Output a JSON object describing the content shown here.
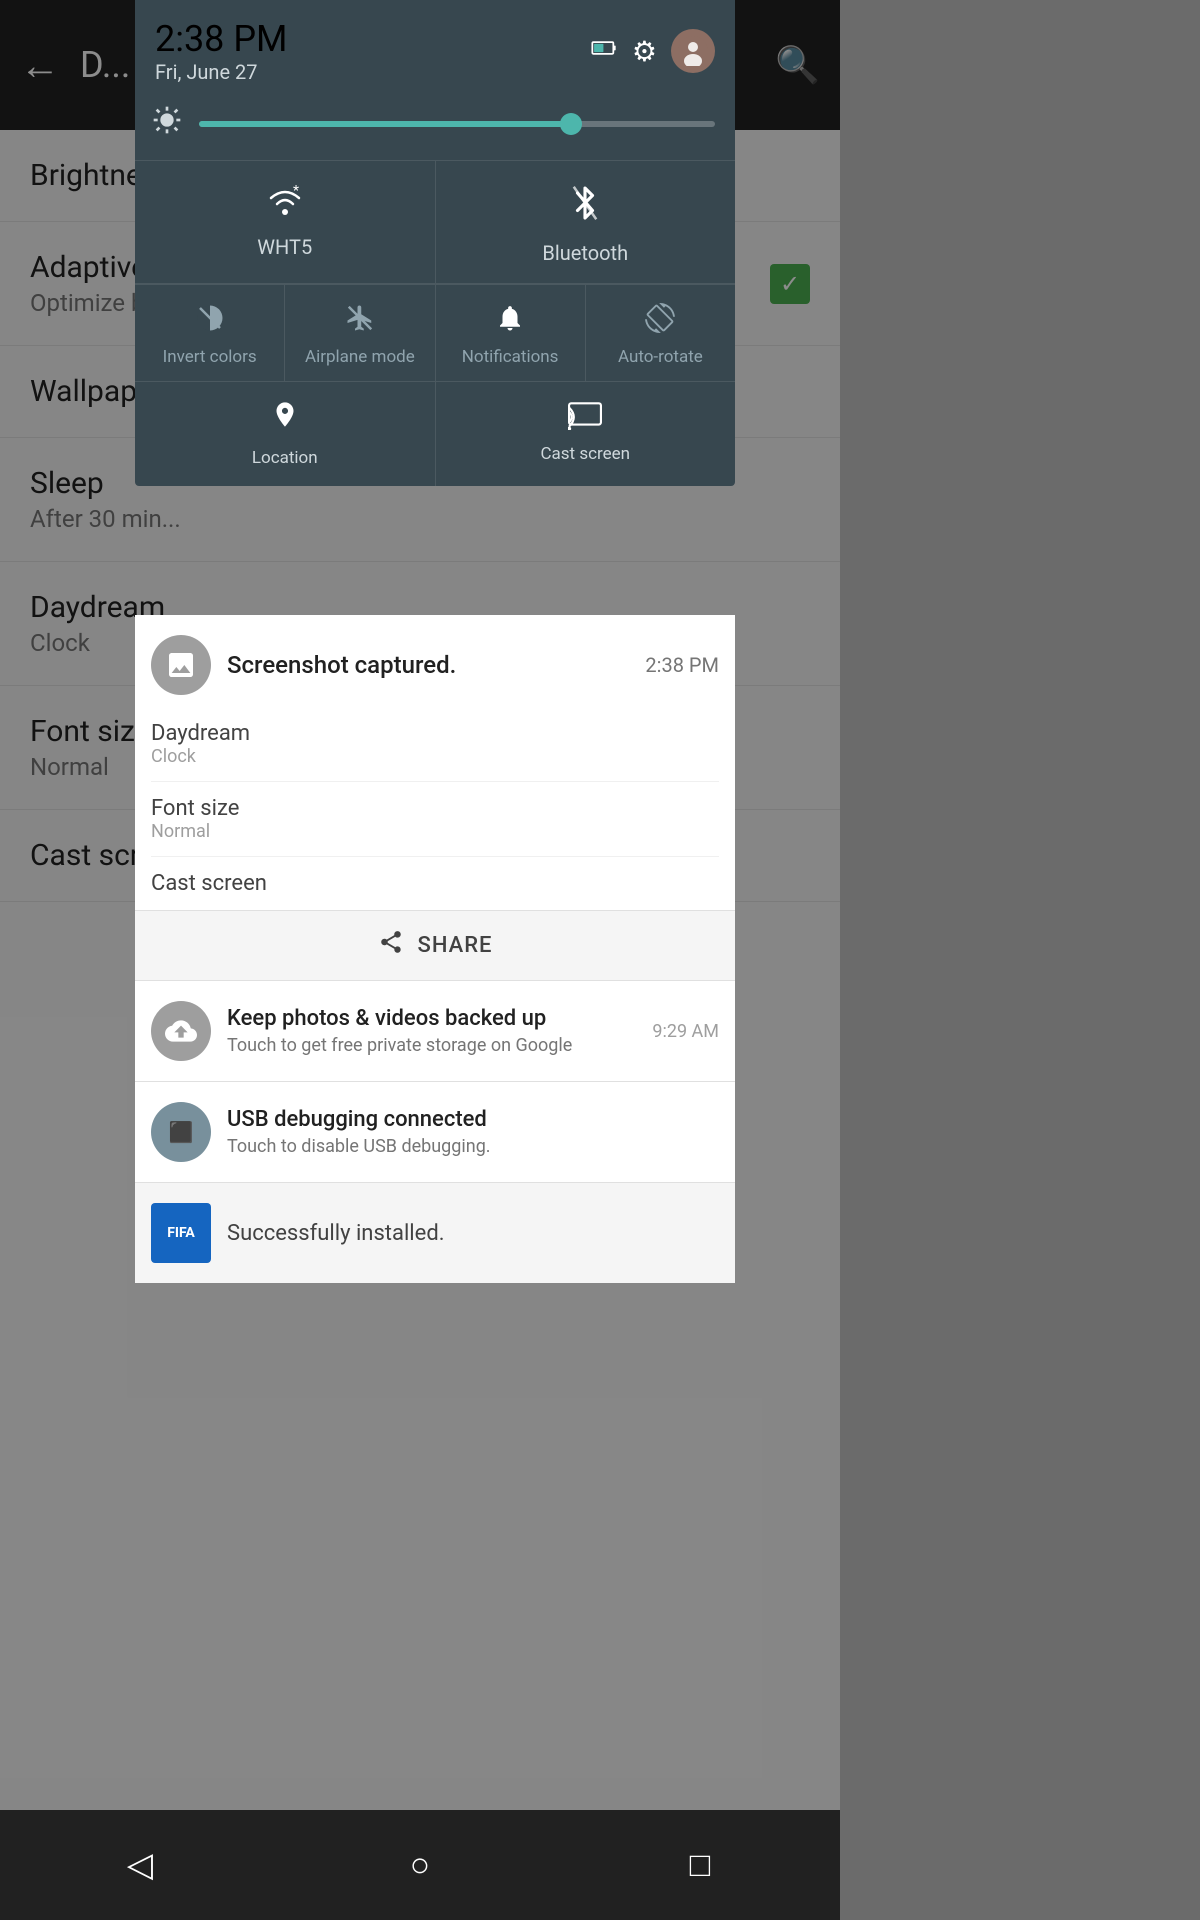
{
  "statusBar": {
    "time": "2:38 PM",
    "date": "Fri, June 27",
    "batteryIcon": "🔋",
    "settingsIcon": "⚙",
    "avatarLabel": "👤"
  },
  "brightness": {
    "iconLabel": "☀",
    "fillPercent": 72
  },
  "wifiTile": {
    "icon": "wifi",
    "label": "WHT5"
  },
  "bluetoothTile": {
    "icon": "bluetooth",
    "label": "Bluetooth"
  },
  "secondaryTiles": [
    {
      "id": "invert-colors",
      "icon": "invert",
      "label": "Invert colors"
    },
    {
      "id": "airplane-mode",
      "icon": "airplane",
      "label": "Airplane mode"
    },
    {
      "id": "notifications",
      "icon": "bell",
      "label": "Notifications"
    },
    {
      "id": "auto-rotate",
      "icon": "rotate",
      "label": "Auto-rotate"
    }
  ],
  "bottomTiles": [
    {
      "id": "location",
      "icon": "pin",
      "label": "Location"
    },
    {
      "id": "cast-screen",
      "icon": "cast",
      "label": "Cast screen"
    }
  ],
  "screenshotNotif": {
    "title": "Screenshot captured.",
    "time": "2:38 PM",
    "iconLabel": "🖼"
  },
  "expandedItems": [
    {
      "id": "daydream",
      "title": "Daydream",
      "sub": "Clock"
    },
    {
      "id": "font-size",
      "title": "Font size",
      "sub": "Normal"
    },
    {
      "id": "cast-screen-item",
      "title": "Cast screen",
      "sub": ""
    }
  ],
  "shareButton": {
    "label": "SHARE"
  },
  "backupNotif": {
    "title": "Keep photos & videos backed up",
    "sub": "Touch to get free private storage on Google",
    "time": "9:29 AM",
    "icon": "↑"
  },
  "usbNotif": {
    "title": "USB debugging connected",
    "sub": "Touch to disable USB debugging.",
    "icon": "⬛"
  },
  "appNotif": {
    "appName": "FIFA",
    "text": "Successfully installed."
  },
  "bgSettings": {
    "items": [
      {
        "id": "brightness",
        "title": "Brightness",
        "sub": ""
      },
      {
        "id": "adaptive-brightness",
        "title": "Adaptive brightness",
        "sub": "Optimize brightness"
      },
      {
        "id": "wallpaper",
        "title": "Wallpaper",
        "sub": ""
      },
      {
        "id": "sleep",
        "title": "Sleep",
        "sub": "After 30 min"
      },
      {
        "id": "daydream",
        "title": "Daydream",
        "sub": "Clock"
      },
      {
        "id": "font-size",
        "title": "Font size",
        "sub": "Normal"
      },
      {
        "id": "cast-screen",
        "title": "Cast screen",
        "sub": ""
      }
    ]
  },
  "navBar": {
    "back": "◁",
    "home": "○",
    "recents": "□"
  }
}
